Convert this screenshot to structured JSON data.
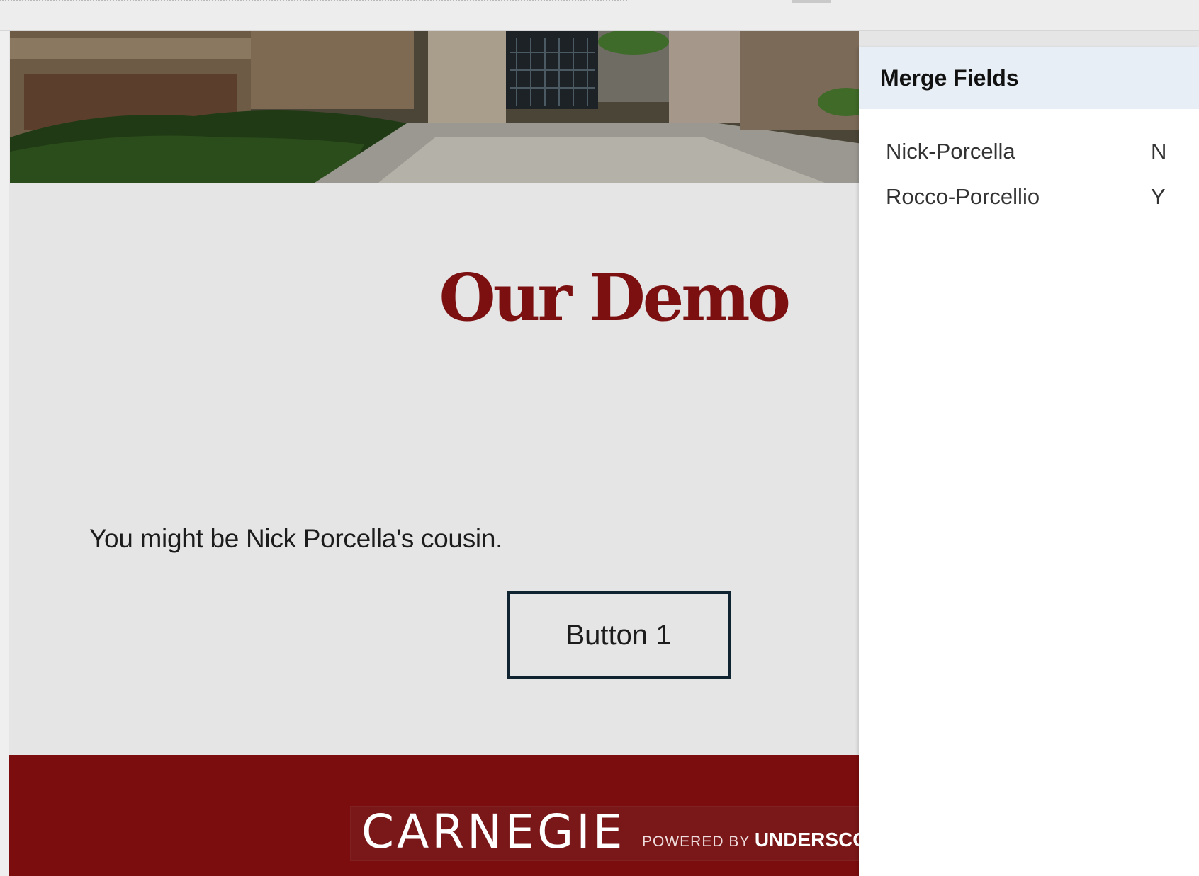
{
  "email": {
    "hero_image": "campus-walkway-photo",
    "title": "Our Demo",
    "body_text": "You might be Nick Porcella's cousin.",
    "button_label": "Button 1",
    "footer": {
      "logo_text": "CARNEGIE",
      "powered_by": "POWERED BY",
      "powered_brand": "UNDERSCO"
    },
    "colors": {
      "brand_red": "#7c0f10",
      "canvas_bg": "#e5e5e5",
      "button_border": "#0f2430"
    }
  },
  "merge_fields": {
    "title": "Merge Fields",
    "rows": [
      {
        "name": "Nick-Porcella",
        "value": "N"
      },
      {
        "name": "Rocco-Porcellio",
        "value": "Y"
      }
    ]
  }
}
